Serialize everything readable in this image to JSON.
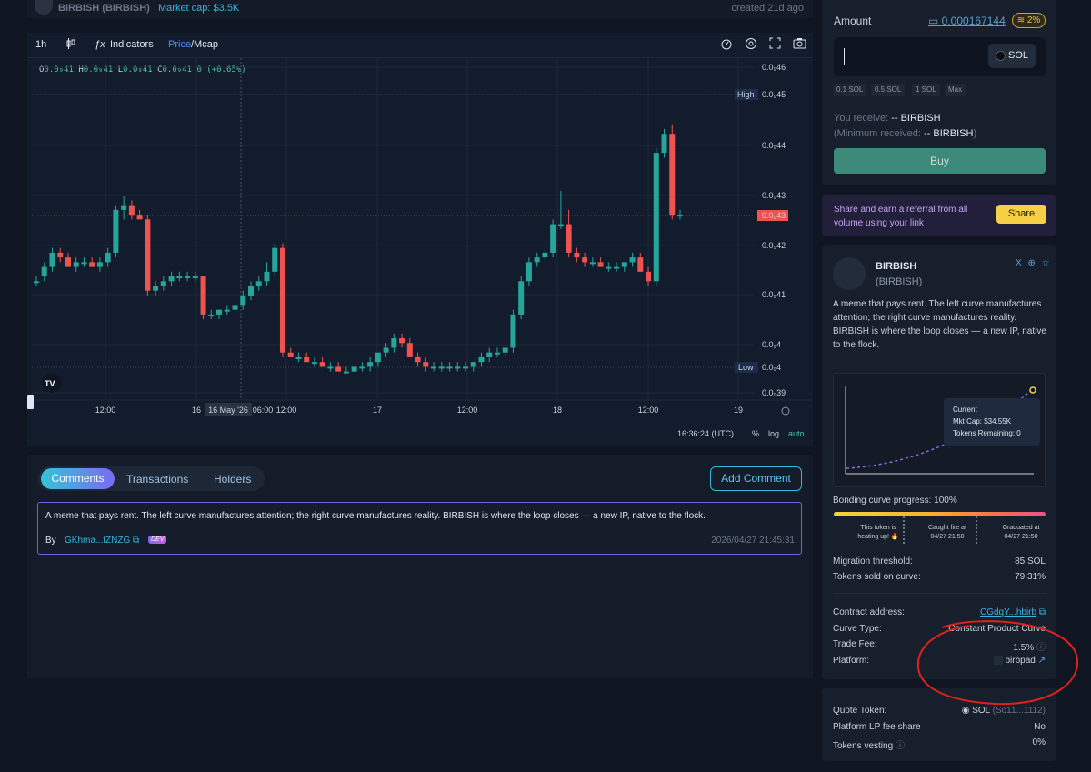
{
  "top": {
    "name": "BIRBISH (BIRBISH)",
    "mcap": "Market cap: $3.5K",
    "created": "created 21d ago"
  },
  "chart": {
    "toolbar": {
      "interval": "1h",
      "indicators": "Indicators",
      "price": "Price",
      "mcap": "/Mcap"
    },
    "ohlc": {
      "o": "0.0₉41",
      "h": "0.0₉41",
      "l": "0.0₉41",
      "c": "0.0₉41",
      "chg": "0 (+0.65%)"
    },
    "time": "16:36:24 (UTC)",
    "pct": "%",
    "log": "log",
    "auto": "auto"
  },
  "chart_data": {
    "type": "candlestick",
    "x_ticks": [
      "12:00",
      "16",
      "16 May '26",
      "06:00",
      "12:00",
      "17",
      "12:00",
      "18",
      "12:00",
      "19"
    ],
    "y_ticks": [
      "0.0₉46",
      "0.0₉45",
      "0.0₉44",
      "0.0₉43",
      "0.0₉43",
      "0.0₉42",
      "0.0₉41",
      "0.0₉4",
      "0.0₉4",
      "0.0₉39"
    ],
    "high_label": "High",
    "low_label": "Low",
    "high_value": "0.0₉45",
    "low_value": "0.0₉4",
    "current_value": "0.0₉43",
    "y_range": [
      39,
      46
    ],
    "candles": [
      [
        41.5,
        41.6,
        41.4,
        41.5
      ],
      [
        41.6,
        41.9,
        41.5,
        41.8
      ],
      [
        41.8,
        42.2,
        41.7,
        42.1
      ],
      [
        42.1,
        42.2,
        41.9,
        42.0
      ],
      [
        42.0,
        42.1,
        41.8,
        41.8
      ],
      [
        41.8,
        42.0,
        41.7,
        41.9
      ],
      [
        41.9,
        42.0,
        41.8,
        41.9
      ],
      [
        41.9,
        42.0,
        41.8,
        41.8
      ],
      [
        41.8,
        42.0,
        41.7,
        41.9
      ],
      [
        41.9,
        42.2,
        41.8,
        42.1
      ],
      [
        42.1,
        43.1,
        42.0,
        43.0
      ],
      [
        43.0,
        43.3,
        42.8,
        43.1
      ],
      [
        43.1,
        43.2,
        42.8,
        42.9
      ],
      [
        42.9,
        43.0,
        42.8,
        42.8
      ],
      [
        42.8,
        42.9,
        41.2,
        41.3
      ],
      [
        41.3,
        41.5,
        41.2,
        41.4
      ],
      [
        41.4,
        41.6,
        41.3,
        41.5
      ],
      [
        41.5,
        41.7,
        41.4,
        41.6
      ],
      [
        41.6,
        41.7,
        41.5,
        41.6
      ],
      [
        41.6,
        41.7,
        41.5,
        41.6
      ],
      [
        41.6,
        41.7,
        41.5,
        41.6
      ],
      [
        41.6,
        41.6,
        40.7,
        40.8
      ],
      [
        40.8,
        40.9,
        40.7,
        40.8
      ],
      [
        40.8,
        40.9,
        40.7,
        40.9
      ],
      [
        40.9,
        41.0,
        40.8,
        40.9
      ],
      [
        40.9,
        41.1,
        40.8,
        41.0
      ],
      [
        41.0,
        41.3,
        40.9,
        41.2
      ],
      [
        41.2,
        41.5,
        41.1,
        41.4
      ],
      [
        41.4,
        41.6,
        41.3,
        41.5
      ],
      [
        41.5,
        41.9,
        41.4,
        41.7
      ],
      [
        41.7,
        42.3,
        41.6,
        42.2
      ],
      [
        42.2,
        42.3,
        39.9,
        40.0
      ],
      [
        40.0,
        40.1,
        39.9,
        39.9
      ],
      [
        39.9,
        40.0,
        39.8,
        39.9
      ],
      [
        39.9,
        40.0,
        39.8,
        39.8
      ],
      [
        39.8,
        39.9,
        39.7,
        39.8
      ],
      [
        39.8,
        39.9,
        39.7,
        39.7
      ],
      [
        39.7,
        39.8,
        39.6,
        39.7
      ],
      [
        39.7,
        39.8,
        39.6,
        39.6
      ],
      [
        39.6,
        39.7,
        39.6,
        39.6
      ],
      [
        39.6,
        39.7,
        39.6,
        39.7
      ],
      [
        39.7,
        39.8,
        39.6,
        39.7
      ],
      [
        39.7,
        39.9,
        39.6,
        39.8
      ],
      [
        39.8,
        40.0,
        39.7,
        40.0
      ],
      [
        40.0,
        40.2,
        39.9,
        40.1
      ],
      [
        40.1,
        40.4,
        40.0,
        40.3
      ],
      [
        40.3,
        40.4,
        40.1,
        40.2
      ],
      [
        40.2,
        40.3,
        39.9,
        39.9
      ],
      [
        39.9,
        40.0,
        39.7,
        39.8
      ],
      [
        39.8,
        39.9,
        39.6,
        39.7
      ],
      [
        39.7,
        39.8,
        39.6,
        39.7
      ],
      [
        39.7,
        39.8,
        39.6,
        39.7
      ],
      [
        39.7,
        39.8,
        39.6,
        39.7
      ],
      [
        39.7,
        39.8,
        39.6,
        39.7
      ],
      [
        39.7,
        39.8,
        39.6,
        39.7
      ],
      [
        39.7,
        39.8,
        39.6,
        39.8
      ],
      [
        39.8,
        40.0,
        39.7,
        39.9
      ],
      [
        39.9,
        40.1,
        39.8,
        40.0
      ],
      [
        40.0,
        40.1,
        39.9,
        40.0
      ],
      [
        40.0,
        40.1,
        39.9,
        40.1
      ],
      [
        40.1,
        40.9,
        40.0,
        40.8
      ],
      [
        40.8,
        41.6,
        40.7,
        41.5
      ],
      [
        41.5,
        42.0,
        41.4,
        41.9
      ],
      [
        41.9,
        42.1,
        41.8,
        42.0
      ],
      [
        42.0,
        42.2,
        41.9,
        42.1
      ],
      [
        42.1,
        42.8,
        42.0,
        42.7
      ],
      [
        42.7,
        43.4,
        42.6,
        42.7
      ],
      [
        42.7,
        43.0,
        42.0,
        42.1
      ],
      [
        42.1,
        42.2,
        41.9,
        42.0
      ],
      [
        42.0,
        42.1,
        41.8,
        41.9
      ],
      [
        41.9,
        42.0,
        41.8,
        41.9
      ],
      [
        41.9,
        42.0,
        41.8,
        41.8
      ],
      [
        41.8,
        41.9,
        41.7,
        41.8
      ],
      [
        41.8,
        41.9,
        41.7,
        41.8
      ],
      [
        41.8,
        41.9,
        41.7,
        41.9
      ],
      [
        41.9,
        42.1,
        41.8,
        42.0
      ],
      [
        42.0,
        42.1,
        41.7,
        41.7
      ],
      [
        41.7,
        41.8,
        41.4,
        41.5
      ],
      [
        41.5,
        44.3,
        41.4,
        44.2
      ],
      [
        44.2,
        44.7,
        44.1,
        44.6
      ],
      [
        44.6,
        44.8,
        42.8,
        42.9
      ],
      [
        42.9,
        43.0,
        42.8,
        42.9
      ]
    ]
  },
  "comments": {
    "tabs": [
      "Comments",
      "Transactions",
      "Holders"
    ],
    "add": "Add Comment",
    "text": "A meme that pays rent. The left curve manufactures attention; the right curve manufactures reality. BIRBISH is where the loop closes — a new IP, native to the flock.",
    "by": "By",
    "user": "GKhma...tZNZG",
    "dev": "DEV",
    "time": "2026/04/27 21:45:31"
  },
  "buy": {
    "amount_label": "Amount",
    "amount_value": "0.000167144",
    "pct": "2%",
    "token": "SOL",
    "quick": [
      "0.1 SOL",
      "0.5 SOL",
      "1 SOL",
      "Max"
    ],
    "receive_label": "You receive:",
    "receive_val": "-- BIRBISH",
    "min_label": "(Minimum received:",
    "min_val": "-- BIRBISH",
    "min_close": ")",
    "button": "Buy"
  },
  "share": {
    "text": "Share and earn a referral from all volume using your link",
    "button": "Share"
  },
  "info": {
    "name": "BIRBISH",
    "ticker": "(BIRBISH)",
    "social": "X ⊕ ☆",
    "desc": "A meme that pays rent. The left curve manufactures attention; the right curve manufactures reality. BIRBISH is where the loop closes — a new IP, native to the flock.",
    "tooltip_title": "Current",
    "tooltip_mcap": "Mkt Cap: $34.55K",
    "tooltip_tokens": "Tokens Remaining: 0",
    "bc_label": "Bonding curve progress: 100%",
    "bonding_progress": 1.0,
    "milestones": [
      "This token is heating up! 🔥",
      "Caught fire at 04/27 21:50",
      "Graduated at 04/27 21:50"
    ],
    "rows": [
      {
        "label": "Migration threshold:",
        "value": "85 SOL"
      },
      {
        "label": "Tokens sold on curve:",
        "value": "79.31%"
      },
      {
        "label": "Contract address:",
        "value": "CGdqY...hbirb"
      },
      {
        "label": "Curve Type:",
        "value": "Constant Product Curve"
      },
      {
        "label": "Trade Fee:",
        "value": "1.5%"
      },
      {
        "label": "Platform:",
        "value": "birbpad"
      }
    ]
  },
  "bottom": {
    "rows": [
      {
        "label": "Quote Token:",
        "value": "SOL",
        "sub": "(So11...1112)"
      },
      {
        "label": "Platform LP fee share",
        "value": "No"
      },
      {
        "label": "Tokens vesting",
        "value": "0%"
      }
    ]
  },
  "colors": {
    "up": "#26a69a",
    "down": "#ef5350",
    "accent": "#37b5e0",
    "annotation": "#e0201c"
  }
}
